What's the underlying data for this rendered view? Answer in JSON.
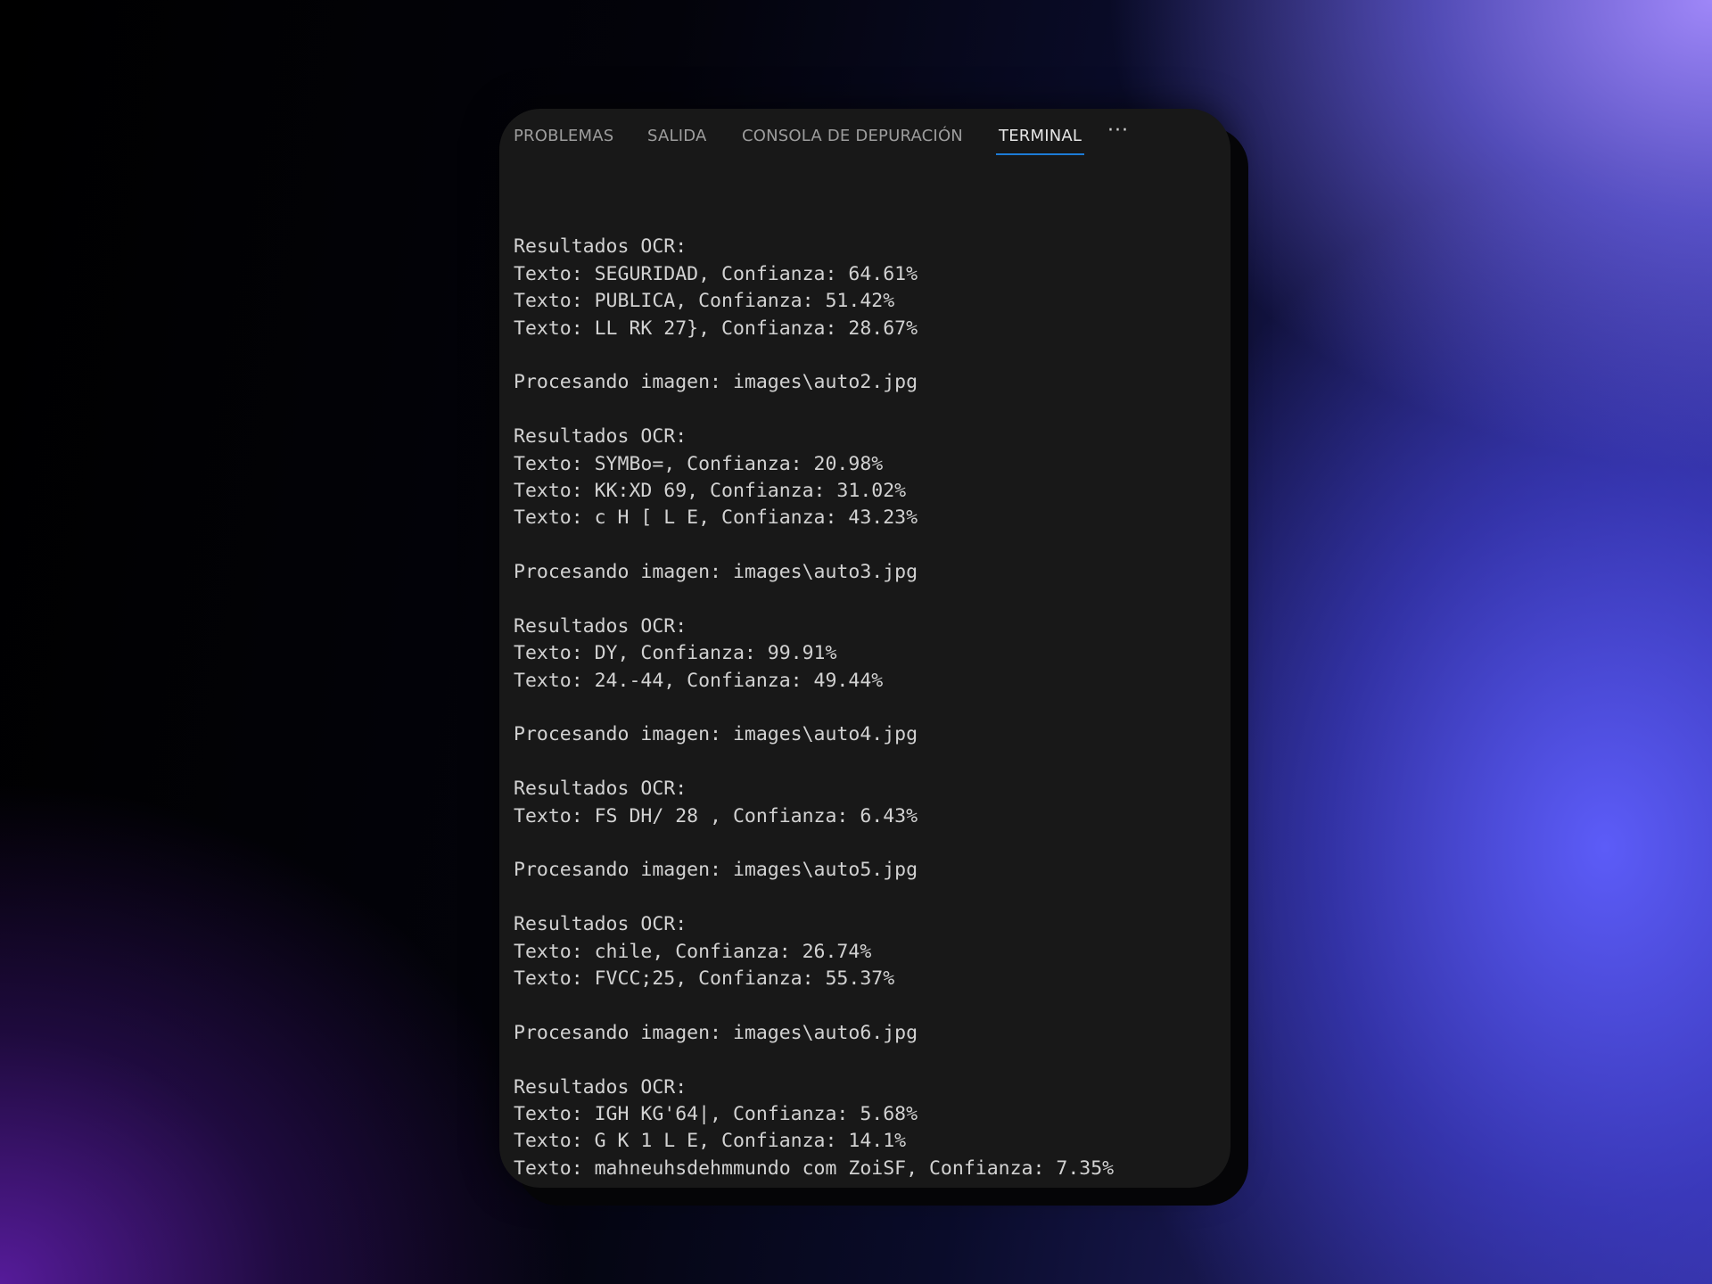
{
  "tabs": [
    {
      "label": "PROBLEMAS",
      "active": false
    },
    {
      "label": "SALIDA",
      "active": false
    },
    {
      "label": "CONSOLA DE DEPURACIÓN",
      "active": false
    },
    {
      "label": "TERMINAL",
      "active": true
    }
  ],
  "more_label": "···",
  "terminal": {
    "lines": [
      "",
      "Resultados OCR:",
      "Texto: SEGURIDAD, Confianza: 64.61%",
      "Texto: PUBLICA, Confianza: 51.42%",
      "Texto: LL RK 27}, Confianza: 28.67%",
      "",
      "Procesando imagen: images\\auto2.jpg",
      "",
      "Resultados OCR:",
      "Texto: SYMBo=, Confianza: 20.98%",
      "Texto: KK:XD 69, Confianza: 31.02%",
      "Texto: c H [ L E, Confianza: 43.23%",
      "",
      "Procesando imagen: images\\auto3.jpg",
      "",
      "Resultados OCR:",
      "Texto: DY, Confianza: 99.91%",
      "Texto: 24.-44, Confianza: 49.44%",
      "",
      "Procesando imagen: images\\auto4.jpg",
      "",
      "Resultados OCR:",
      "Texto: FS DH/ 28 , Confianza: 6.43%",
      "",
      "Procesando imagen: images\\auto5.jpg",
      "",
      "Resultados OCR:",
      "Texto: chile, Confianza: 26.74%",
      "Texto: FVCC;25, Confianza: 55.37%",
      "",
      "Procesando imagen: images\\auto6.jpg",
      "",
      "Resultados OCR:",
      "Texto: IGH KG'64|, Confianza: 5.68%",
      "Texto: G K 1 L E, Confianza: 14.1%",
      "Texto: mahneuhsdehmmundo com ZoiSF, Confianza: 7.35%"
    ]
  }
}
